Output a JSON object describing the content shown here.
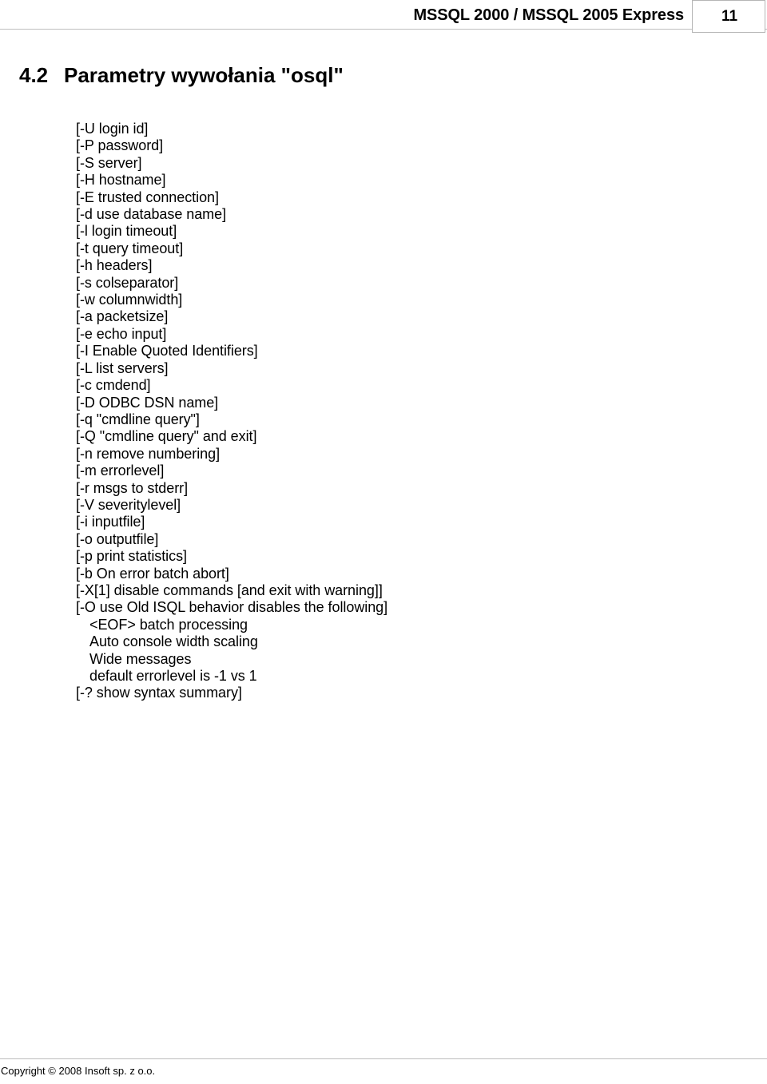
{
  "header": {
    "title": "MSSQL 2000 / MSSQL 2005 Express",
    "page_number": "11"
  },
  "heading": {
    "number": "4.2",
    "text": "Parametry wywołania \"osql\""
  },
  "params": [
    {
      "text": "[-U login id]",
      "indent": 0
    },
    {
      "text": "[-P password]",
      "indent": 0
    },
    {
      "text": "[-S server]",
      "indent": 0
    },
    {
      "text": "[-H hostname]",
      "indent": 0
    },
    {
      "text": "[-E trusted connection]",
      "indent": 0
    },
    {
      "text": "[-d use database name]",
      "indent": 0
    },
    {
      "text": "[-l login timeout]",
      "indent": 0
    },
    {
      "text": "[-t query timeout]",
      "indent": 0
    },
    {
      "text": "[-h headers]",
      "indent": 0
    },
    {
      "text": "[-s colseparator]",
      "indent": 0
    },
    {
      "text": "[-w columnwidth]",
      "indent": 0
    },
    {
      "text": "[-a packetsize]",
      "indent": 0
    },
    {
      "text": "[-e echo input]",
      "indent": 0
    },
    {
      "text": "[-I Enable Quoted Identifiers]",
      "indent": 0
    },
    {
      "text": "[-L list servers]",
      "indent": 0
    },
    {
      "text": "[-c cmdend]",
      "indent": 0
    },
    {
      "text": "[-D ODBC DSN name]",
      "indent": 0
    },
    {
      "text": "[-q \"cmdline query\"]",
      "indent": 0
    },
    {
      "text": "[-Q \"cmdline query\" and exit]",
      "indent": 0
    },
    {
      "text": "[-n remove numbering]",
      "indent": 0
    },
    {
      "text": "[-m errorlevel]",
      "indent": 0
    },
    {
      "text": "[-r msgs to stderr]",
      "indent": 0
    },
    {
      "text": "[-V severitylevel]",
      "indent": 0
    },
    {
      "text": "[-i inputfile]",
      "indent": 0
    },
    {
      "text": "[-o outputfile]",
      "indent": 0
    },
    {
      "text": "[-p print statistics]",
      "indent": 0
    },
    {
      "text": "[-b On error batch abort]",
      "indent": 0
    },
    {
      "text": "[-X[1] disable commands [and exit with warning]]",
      "indent": 0
    },
    {
      "text": "[-O use Old ISQL behavior disables the following]",
      "indent": 0
    },
    {
      "text": "<EOF> batch processing",
      "indent": 1
    },
    {
      "text": "Auto console width scaling",
      "indent": 1
    },
    {
      "text": "Wide messages",
      "indent": 1
    },
    {
      "text": "default errorlevel is -1 vs 1",
      "indent": 1
    },
    {
      "text": "[-? show syntax summary]",
      "indent": 0
    }
  ],
  "footer": {
    "copyright": "Copyright © 2008 Insoft sp. z o.o."
  }
}
